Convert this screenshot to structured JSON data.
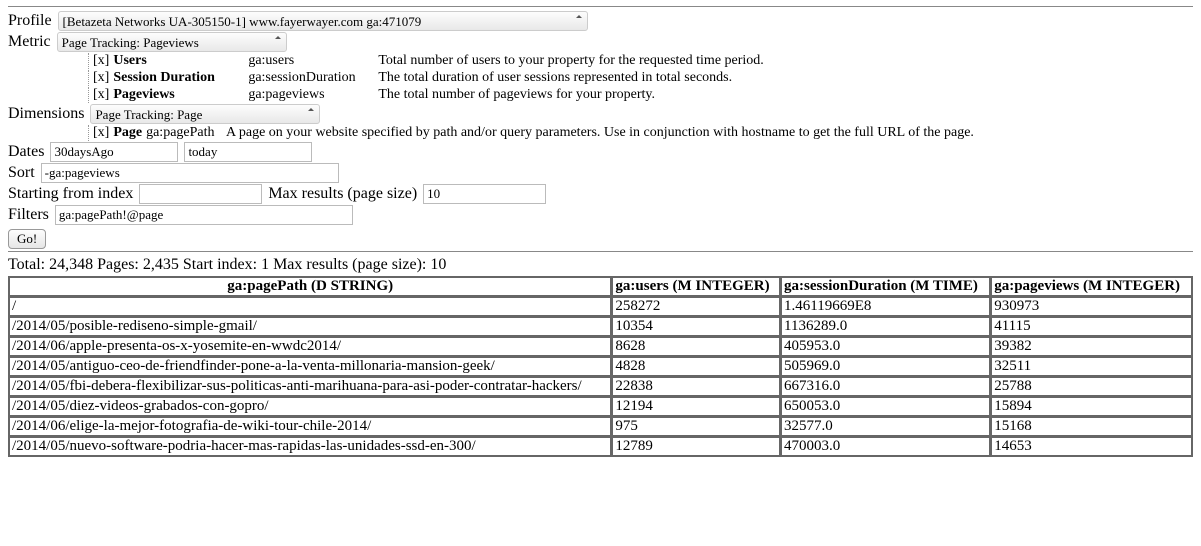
{
  "labels": {
    "profile": "Profile",
    "metric": "Metric",
    "dimensions": "Dimensions",
    "dates": "Dates",
    "sort": "Sort",
    "start_index": "Starting from index",
    "max_results": "Max results (page size)",
    "filters": "Filters",
    "go": "Go!"
  },
  "profile": {
    "selected": "[Betazeta Networks UA-305150-1] www.fayerwayer.com ga:471079"
  },
  "metric": {
    "selected": "Page Tracking: Pageviews",
    "items": [
      {
        "x": "[x]",
        "name": "Users",
        "code": "ga:users",
        "desc": "Total number of users to your property for the requested time period."
      },
      {
        "x": "[x]",
        "name": "Session Duration",
        "code": "ga:sessionDuration",
        "desc": "The total duration of user sessions represented in total seconds."
      },
      {
        "x": "[x]",
        "name": "Pageviews",
        "code": "ga:pageviews",
        "desc": "The total number of pageviews for your property."
      }
    ]
  },
  "dimensions": {
    "selected": "Page Tracking: Page",
    "items": [
      {
        "x": "[x]",
        "name": "Page",
        "code": "ga:pagePath",
        "desc": "A page on your website specified by path and/or query parameters. Use in conjunction with hostname to get the full URL of the page."
      }
    ]
  },
  "dates": {
    "from": "30daysAgo",
    "to": "today"
  },
  "sort": "-ga:pageviews",
  "start_index": "",
  "max_results": "10",
  "filters": "ga:pagePath!@page",
  "summary": "Total: 24,348 Pages: 2,435 Start index: 1 Max results (page size): 10",
  "table": {
    "headers": [
      "ga:pagePath (D STRING)",
      "ga:users (M INTEGER)",
      "ga:sessionDuration (M TIME)",
      "ga:pageviews (M INTEGER)"
    ],
    "rows": [
      [
        "/",
        "258272",
        "1.46119669E8",
        "930973"
      ],
      [
        "/2014/05/posible-rediseno-simple-gmail/",
        "10354",
        "1136289.0",
        "41115"
      ],
      [
        "/2014/06/apple-presenta-os-x-yosemite-en-wwdc2014/",
        "8628",
        "405953.0",
        "39382"
      ],
      [
        "/2014/05/antiguo-ceo-de-friendfinder-pone-a-la-venta-millonaria-mansion-geek/",
        "4828",
        "505969.0",
        "32511"
      ],
      [
        "/2014/05/fbi-debera-flexibilizar-sus-politicas-anti-marihuana-para-asi-poder-contratar-hackers/",
        "22838",
        "667316.0",
        "25788"
      ],
      [
        "/2014/05/diez-videos-grabados-con-gopro/",
        "12194",
        "650053.0",
        "15894"
      ],
      [
        "/2014/06/elige-la-mejor-fotografia-de-wiki-tour-chile-2014/",
        "975",
        "32577.0",
        "15168"
      ],
      [
        "/2014/05/nuevo-software-podria-hacer-mas-rapidas-las-unidades-ssd-en-300/",
        "12789",
        "470003.0",
        "14653"
      ]
    ]
  }
}
